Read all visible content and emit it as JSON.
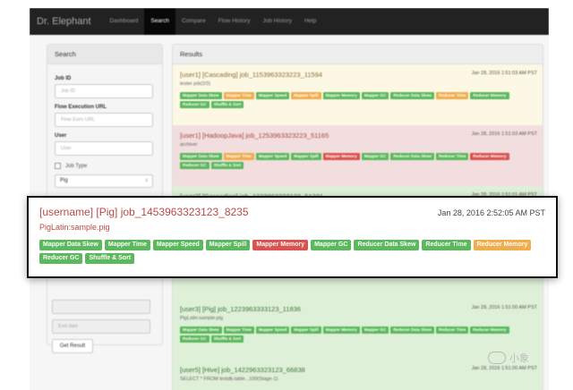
{
  "navbar": {
    "brand": "Dr. Elephant",
    "items": [
      "Dashboard",
      "Search",
      "Compare",
      "Flow History",
      "Job History",
      "Help"
    ],
    "active": "Search"
  },
  "search_panel": {
    "title": "Search",
    "job_id_label": "Job ID",
    "job_id_placeholder": "Job ID",
    "flow_url_label": "Flow Execution URL",
    "flow_url_placeholder": "Flow Exec URL",
    "user_label": "User",
    "user_placeholder": "User",
    "job_type_label": "Job Type",
    "job_type_value": "Pig",
    "end_date_placeholder": "End date",
    "get_result_label": "Get Result"
  },
  "results": {
    "title": "Results",
    "rows": [
      {
        "title": "[user1] [Cascading] job_1153963323223_11594",
        "time": "Jan 28, 2016 1:51:03 AM PST",
        "subtitle": "tester job(2/3)",
        "badges": [
          {
            "label": "Mapper Data Skew",
            "color": "g"
          },
          {
            "label": "Mapper Time",
            "color": "o"
          },
          {
            "label": "Mapper Speed",
            "color": "g"
          },
          {
            "label": "Mapper Spill",
            "color": "o"
          },
          {
            "label": "Mapper Memory",
            "color": "g"
          },
          {
            "label": "Mapper GC",
            "color": "g"
          },
          {
            "label": "Reducer Data Skew",
            "color": "g"
          },
          {
            "label": "Reducer Time",
            "color": "o"
          },
          {
            "label": "Reducer Memory",
            "color": "g"
          },
          {
            "label": "Reducer GC",
            "color": "g"
          },
          {
            "label": "Shuffle & Sort",
            "color": "g"
          }
        ]
      },
      {
        "title": "[user1] [HadoopJava] job_1253963323223_51165",
        "time": "Jan 28, 2016 1:51:03 AM PST",
        "subtitle": "archiver",
        "badges": [
          {
            "label": "Mapper Data Skew",
            "color": "g"
          },
          {
            "label": "Mapper Time",
            "color": "o"
          },
          {
            "label": "Mapper Speed",
            "color": "g"
          },
          {
            "label": "Mapper Spill",
            "color": "g"
          },
          {
            "label": "Mapper Memory",
            "color": "r"
          },
          {
            "label": "Mapper GC",
            "color": "g"
          },
          {
            "label": "Reducer Data Skew",
            "color": "g"
          },
          {
            "label": "Reducer Time",
            "color": "g"
          },
          {
            "label": "Reducer Memory",
            "color": "r"
          },
          {
            "label": "Reducer GC",
            "color": "g"
          },
          {
            "label": "Shuffle & Sort",
            "color": "g"
          }
        ]
      },
      {
        "title": "[user2] [Cascading] job_1233963323123_51221",
        "time": "Jan 28, 2016 1:51:01 AM PST",
        "subtitle": "",
        "badges": []
      },
      {
        "title": "[user3] [Pig] job_1223963333123_11836",
        "time": "Jan 28, 2016 1:51:00 AM PST",
        "subtitle": "PigLatin:sample.pig",
        "badges": [
          {
            "label": "Mapper Data Skew",
            "color": "g"
          },
          {
            "label": "Mapper Time",
            "color": "g"
          },
          {
            "label": "Mapper Speed",
            "color": "g"
          },
          {
            "label": "Mapper Spill",
            "color": "g"
          },
          {
            "label": "Mapper Memory",
            "color": "g"
          },
          {
            "label": "Mapper GC",
            "color": "g"
          },
          {
            "label": "Reducer Data Skew",
            "color": "g"
          },
          {
            "label": "Reducer Time",
            "color": "g"
          },
          {
            "label": "Reducer Memory",
            "color": "g"
          },
          {
            "label": "Reducer GC",
            "color": "g"
          },
          {
            "label": "Shuffle & Sort",
            "color": "g"
          }
        ]
      },
      {
        "title": "[user5] [Hive] job_1422963323123_66838",
        "time": "Jan 28, 2016 1:51:00 AM PST",
        "subtitle": "SELECT * FROM testdb.table...100(Stage-1)",
        "badges": []
      }
    ]
  },
  "highlight": {
    "title": "[username] [Pig] job_1453963323123_8235",
    "time": "Jan 28, 2016 2:52:05 AM PST",
    "subtitle": "PigLatin:sample.pig",
    "badges": [
      {
        "label": "Mapper Data Skew",
        "color": "g"
      },
      {
        "label": "Mapper Time",
        "color": "g"
      },
      {
        "label": "Mapper Speed",
        "color": "g"
      },
      {
        "label": "Mapper Spill",
        "color": "g"
      },
      {
        "label": "Mapper Memory",
        "color": "r"
      },
      {
        "label": "Mapper GC",
        "color": "g"
      },
      {
        "label": "Reducer Data Skew",
        "color": "g"
      },
      {
        "label": "Reducer Time",
        "color": "g"
      },
      {
        "label": "Reducer Memory",
        "color": "o"
      },
      {
        "label": "Reducer GC",
        "color": "g"
      },
      {
        "label": "Shuffle & Sort",
        "color": "g"
      }
    ]
  },
  "colors": {
    "g": "#5cb85c",
    "o": "#f0ad4e",
    "r": "#d9534f"
  },
  "watermark": {
    "text": "小象",
    "icon": "wechat-icon"
  }
}
